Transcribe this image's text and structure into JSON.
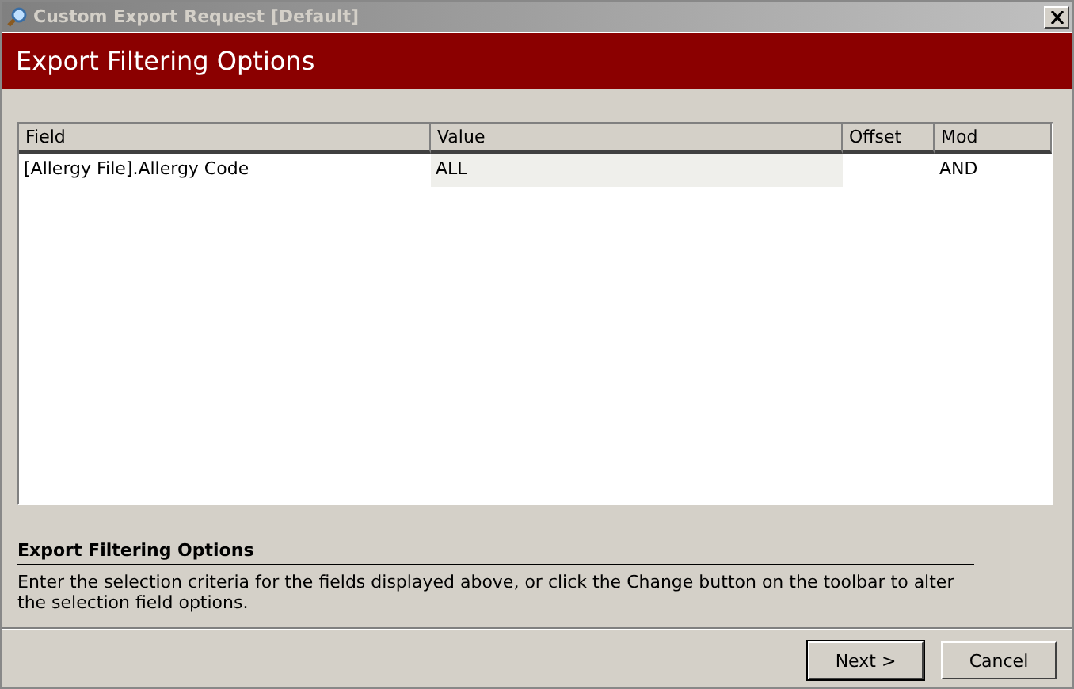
{
  "window": {
    "title": "Custom Export Request [Default]"
  },
  "header": {
    "title": "Export Filtering Options"
  },
  "table": {
    "columns": [
      "Field",
      "Value",
      "Offset",
      "Mod"
    ],
    "rows": [
      {
        "cells": [
          "[Allergy File].Allergy Code",
          "ALL",
          "",
          "AND"
        ]
      }
    ]
  },
  "info": {
    "title": "Export Filtering Options",
    "text": "Enter the selection criteria for the fields displayed above, or click the Change button on the toolbar to alter the selection field options."
  },
  "buttons": [
    {
      "label": "Next >",
      "default": true
    },
    {
      "label": "Cancel",
      "default": false
    }
  ]
}
